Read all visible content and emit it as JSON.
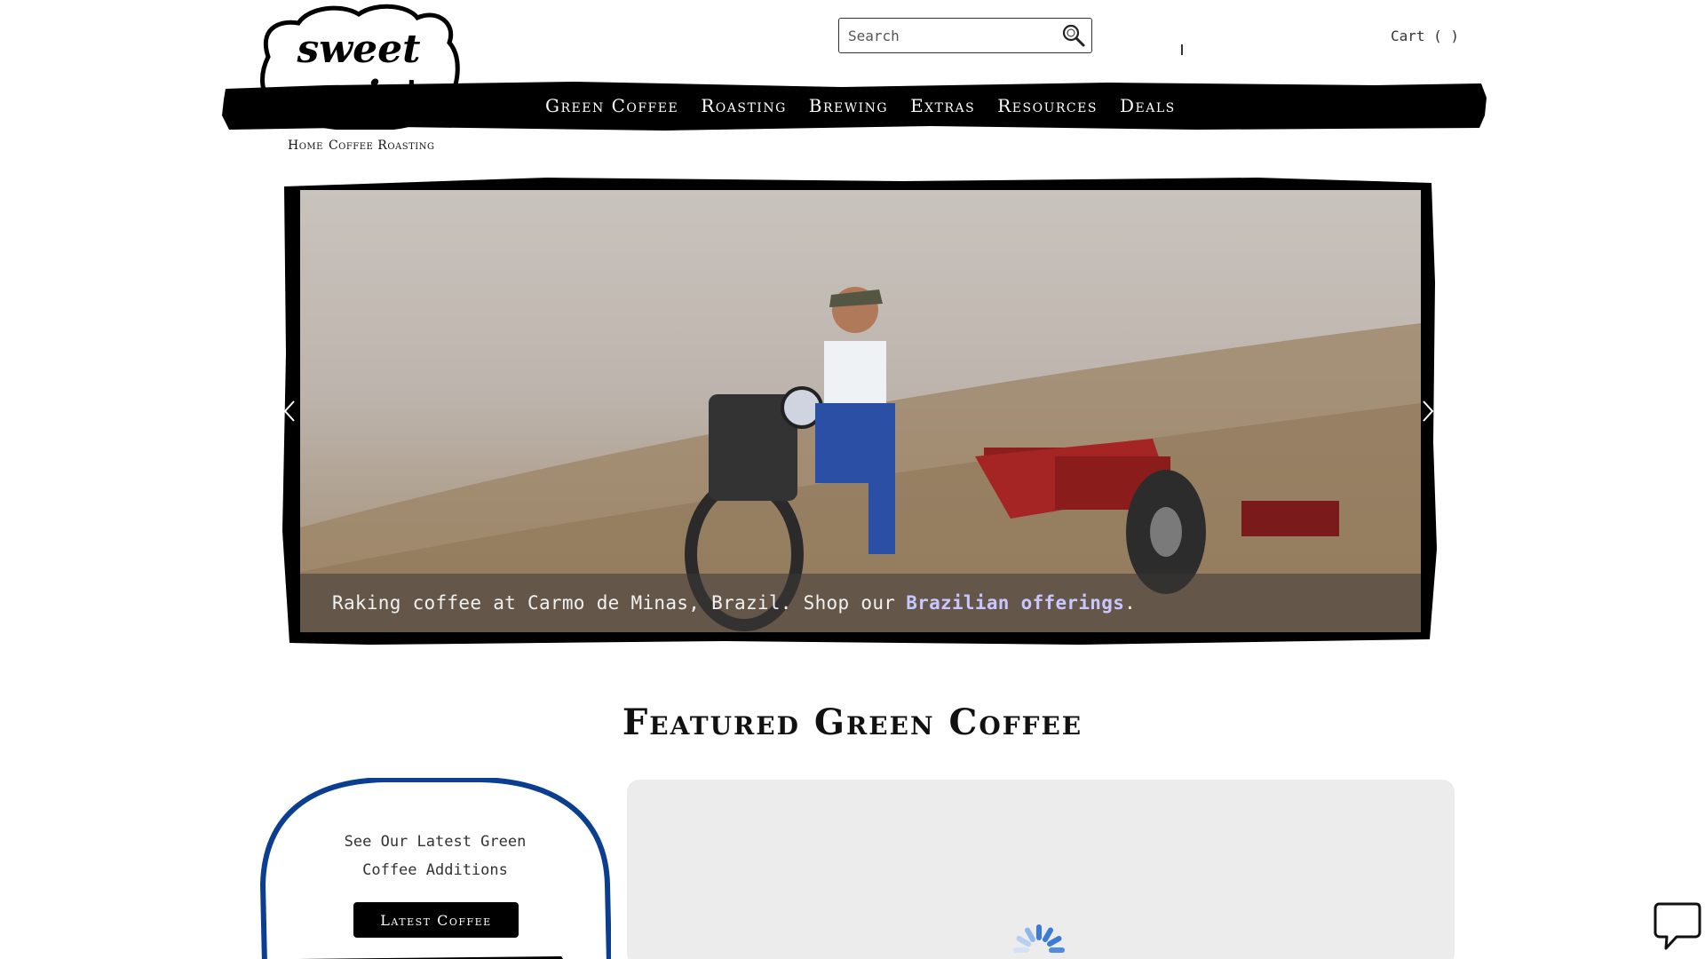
{
  "brand": {
    "logo_line1": "sweet",
    "logo_line2": "maria's"
  },
  "header": {
    "search": {
      "placeholder": "Search",
      "value": ""
    },
    "cart_label": "Cart ( )"
  },
  "nav": {
    "items": [
      {
        "label": "Green Coffee"
      },
      {
        "label": "Roasting"
      },
      {
        "label": "Brewing"
      },
      {
        "label": "Extras"
      },
      {
        "label": "Resources"
      },
      {
        "label": "Deals"
      }
    ]
  },
  "breadcrumb": {
    "items": [
      {
        "label": "Home"
      },
      {
        "label": "Coffee Roasting"
      }
    ]
  },
  "hero": {
    "caption_text": "Raking coffee at Carmo de Minas, Brazil. Shop our",
    "caption_link": "Brazilian offerings",
    "caption_end": "."
  },
  "featured": {
    "title": "Featured Green Coffee",
    "latest_text_line1": "See Our Latest Green",
    "latest_text_line2": "Coffee Additions",
    "latest_button": "Latest Coffee"
  },
  "colors": {
    "accent_blue": "#0b3d91",
    "nav_bg": "#000000",
    "caption_link": "#c9c7ff",
    "panel_bg": "#ececec"
  },
  "icons": {
    "search": "search-icon",
    "prev": "chevron-left-icon",
    "next": "chevron-right-icon",
    "chat": "chat-bubble-icon",
    "loading": "loading-spinner-icon"
  }
}
